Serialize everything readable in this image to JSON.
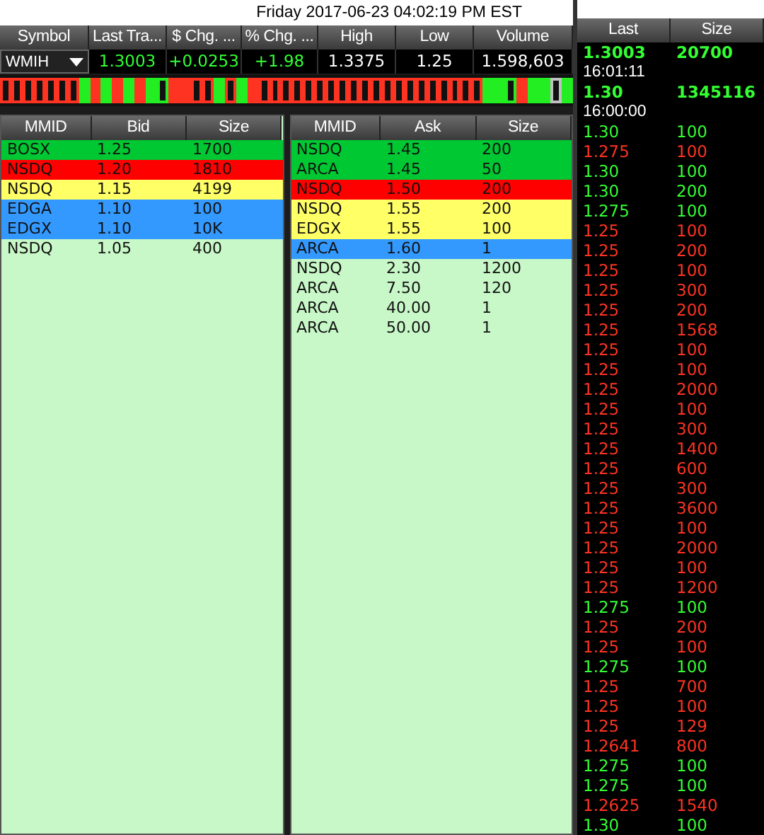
{
  "title": "Friday 2017-06-23 04:02:19 PM EST",
  "quote": {
    "columns": [
      "Symbol",
      "Last Tra...",
      "$ Chg. ...",
      "% Chg. ...",
      "High",
      "Low",
      "Volume"
    ],
    "symbol": "WMIH",
    "values": [
      {
        "text": "1.3003",
        "color": "#33ff33"
      },
      {
        "text": "+0.0253",
        "color": "#33ff33"
      },
      {
        "text": "+1.98",
        "color": "#33ff33"
      },
      {
        "text": "1.3375",
        "color": "#ffffff"
      },
      {
        "text": "1.25",
        "color": "#ffffff"
      },
      {
        "text": "1.598,603",
        "color": "#ffffff"
      }
    ]
  },
  "ticks": [
    {
      "color": "#ff3322",
      "filled": false
    },
    {
      "color": "#ff3322",
      "filled": false
    },
    {
      "color": "#ff3322",
      "filled": false
    },
    {
      "color": "#ff3322",
      "filled": false
    },
    {
      "color": "#ff3322",
      "filled": false
    },
    {
      "color": "#ff3322",
      "filled": false
    },
    {
      "color": "#ff3322",
      "filled": false
    },
    {
      "color": "#22ee22",
      "filled": true
    },
    {
      "color": "#ff3322",
      "filled": true
    },
    {
      "color": "#22ee22",
      "filled": true
    },
    {
      "color": "#ff3322",
      "filled": true
    },
    {
      "color": "#22ee22",
      "filled": true
    },
    {
      "color": "#ff3322",
      "filled": true
    },
    {
      "color": "#22ee22",
      "filled": true
    },
    {
      "color": "#22ee22",
      "filled": false
    },
    {
      "color": "#ff3322",
      "filled": true
    },
    {
      "color": "#ff3322",
      "filled": true
    },
    {
      "color": "#ff3322",
      "filled": false
    },
    {
      "color": "#ff3322",
      "filled": false
    },
    {
      "color": "#22ee22",
      "filled": true
    },
    {
      "color": "#ff3322",
      "filled": false
    },
    {
      "color": "#22ee22",
      "filled": true
    },
    {
      "color": "#ff3322",
      "filled": true
    },
    {
      "color": "#ff3322",
      "filled": false
    },
    {
      "color": "#ff3322",
      "filled": false
    },
    {
      "color": "#ff3322",
      "filled": false
    },
    {
      "color": "#ff3322",
      "filled": false
    },
    {
      "color": "#ff3322",
      "filled": false
    },
    {
      "color": "#ff3322",
      "filled": false
    },
    {
      "color": "#ff3322",
      "filled": false
    },
    {
      "color": "#ff3322",
      "filled": false
    },
    {
      "color": "#ff3322",
      "filled": false
    },
    {
      "color": "#ff3322",
      "filled": false
    },
    {
      "color": "#ff3322",
      "filled": false
    },
    {
      "color": "#ff3322",
      "filled": false
    },
    {
      "color": "#ff3322",
      "filled": false
    },
    {
      "color": "#ff3322",
      "filled": false
    },
    {
      "color": "#ff3322",
      "filled": false
    },
    {
      "color": "#ff3322",
      "filled": false
    },
    {
      "color": "#ff3322",
      "filled": false
    },
    {
      "color": "#ff3322",
      "filled": false
    },
    {
      "color": "#ff3322",
      "filled": false
    },
    {
      "color": "#ff3322",
      "filled": false
    },
    {
      "color": "#22ee22",
      "filled": true
    },
    {
      "color": "#22ee22",
      "filled": true
    },
    {
      "color": "#22ee22",
      "filled": false
    },
    {
      "color": "#ff3322",
      "filled": true
    },
    {
      "color": "#22ee22",
      "filled": true
    },
    {
      "color": "#22ee22",
      "filled": true
    },
    {
      "color": "#c0c0c0",
      "filled": false
    },
    {
      "color": "#22ee22",
      "filled": true
    }
  ],
  "bid": {
    "columns": [
      "MMID",
      "Bid",
      "Size"
    ],
    "rows": [
      {
        "cells": [
          "BOSX",
          "1.25",
          "1700"
        ],
        "color": "#00c832"
      },
      {
        "cells": [
          "NSDQ",
          "1.20",
          "1810"
        ],
        "color": "#ff0000"
      },
      {
        "cells": [
          "NSDQ",
          "1.15",
          "4199"
        ],
        "color": "#ffff66"
      },
      {
        "cells": [
          "EDGA",
          "1.10",
          "100"
        ],
        "color": "#3399ff"
      },
      {
        "cells": [
          "EDGX",
          "1.10",
          "10K"
        ],
        "color": "#3399ff"
      },
      {
        "cells": [
          "NSDQ",
          "1.05",
          "400"
        ],
        "color": "#c8f8c8"
      }
    ]
  },
  "ask": {
    "columns": [
      "MMID",
      "Ask",
      "Size"
    ],
    "rows": [
      {
        "cells": [
          "NSDQ",
          "1.45",
          "200"
        ],
        "color": "#00c832"
      },
      {
        "cells": [
          "ARCA",
          "1.45",
          "50"
        ],
        "color": "#00c832"
      },
      {
        "cells": [
          "NSDQ",
          "1.50",
          "200"
        ],
        "color": "#ff0000"
      },
      {
        "cells": [
          "NSDQ",
          "1.55",
          "200"
        ],
        "color": "#ffff66"
      },
      {
        "cells": [
          "EDGX",
          "1.55",
          "100"
        ],
        "color": "#ffff66"
      },
      {
        "cells": [
          "ARCA",
          "1.60",
          "1"
        ],
        "color": "#3399ff"
      },
      {
        "cells": [
          "NSDQ",
          "2.30",
          "1200"
        ],
        "color": "#c8f8c8"
      },
      {
        "cells": [
          "ARCA",
          "7.50",
          "120"
        ],
        "color": "#c8f8c8"
      },
      {
        "cells": [
          "ARCA",
          "40.00",
          "1"
        ],
        "color": "#c8f8c8"
      },
      {
        "cells": [
          "ARCA",
          "50.00",
          "1"
        ],
        "color": "#c8f8c8"
      }
    ]
  },
  "time_sales": {
    "columns": [
      "Last",
      "Size"
    ],
    "rows": [
      {
        "kind": "summary",
        "last": "1.3003",
        "size": "20700",
        "color": "#33ff33"
      },
      {
        "kind": "time",
        "last": "16:01:11"
      },
      {
        "kind": "summary",
        "last": "1.30",
        "size": "1345116",
        "color": "#33ff33"
      },
      {
        "kind": "time",
        "last": "16:00:00"
      },
      {
        "kind": "trade",
        "last": "1.30",
        "size": "100",
        "color": "#33ff33"
      },
      {
        "kind": "trade",
        "last": "1.275",
        "size": "100",
        "color": "#ff3322"
      },
      {
        "kind": "trade",
        "last": "1.30",
        "size": "100",
        "color": "#33ff33"
      },
      {
        "kind": "trade",
        "last": "1.30",
        "size": "200",
        "color": "#33ff33"
      },
      {
        "kind": "trade",
        "last": "1.275",
        "size": "100",
        "color": "#33ff33"
      },
      {
        "kind": "trade",
        "last": "1.25",
        "size": "100",
        "color": "#ff3322"
      },
      {
        "kind": "trade",
        "last": "1.25",
        "size": "200",
        "color": "#ff3322"
      },
      {
        "kind": "trade",
        "last": "1.25",
        "size": "100",
        "color": "#ff3322"
      },
      {
        "kind": "trade",
        "last": "1.25",
        "size": "300",
        "color": "#ff3322"
      },
      {
        "kind": "trade",
        "last": "1.25",
        "size": "200",
        "color": "#ff3322"
      },
      {
        "kind": "trade",
        "last": "1.25",
        "size": "1568",
        "color": "#ff3322"
      },
      {
        "kind": "trade",
        "last": "1.25",
        "size": "100",
        "color": "#ff3322"
      },
      {
        "kind": "trade",
        "last": "1.25",
        "size": "100",
        "color": "#ff3322"
      },
      {
        "kind": "trade",
        "last": "1.25",
        "size": "2000",
        "color": "#ff3322"
      },
      {
        "kind": "trade",
        "last": "1.25",
        "size": "100",
        "color": "#ff3322"
      },
      {
        "kind": "trade",
        "last": "1.25",
        "size": "300",
        "color": "#ff3322"
      },
      {
        "kind": "trade",
        "last": "1.25",
        "size": "1400",
        "color": "#ff3322"
      },
      {
        "kind": "trade",
        "last": "1.25",
        "size": "600",
        "color": "#ff3322"
      },
      {
        "kind": "trade",
        "last": "1.25",
        "size": "300",
        "color": "#ff3322"
      },
      {
        "kind": "trade",
        "last": "1.25",
        "size": "3600",
        "color": "#ff3322"
      },
      {
        "kind": "trade",
        "last": "1.25",
        "size": "100",
        "color": "#ff3322"
      },
      {
        "kind": "trade",
        "last": "1.25",
        "size": "2000",
        "color": "#ff3322"
      },
      {
        "kind": "trade",
        "last": "1.25",
        "size": "100",
        "color": "#ff3322"
      },
      {
        "kind": "trade",
        "last": "1.25",
        "size": "1200",
        "color": "#ff3322"
      },
      {
        "kind": "trade",
        "last": "1.275",
        "size": "100",
        "color": "#33ff33"
      },
      {
        "kind": "trade",
        "last": "1.25",
        "size": "200",
        "color": "#ff3322"
      },
      {
        "kind": "trade",
        "last": "1.25",
        "size": "100",
        "color": "#ff3322"
      },
      {
        "kind": "trade",
        "last": "1.275",
        "size": "100",
        "color": "#33ff33"
      },
      {
        "kind": "trade",
        "last": "1.25",
        "size": "700",
        "color": "#ff3322"
      },
      {
        "kind": "trade",
        "last": "1.25",
        "size": "100",
        "color": "#ff3322"
      },
      {
        "kind": "trade",
        "last": "1.25",
        "size": "129",
        "color": "#ff3322"
      },
      {
        "kind": "trade",
        "last": "1.2641",
        "size": "800",
        "color": "#ff3322"
      },
      {
        "kind": "trade",
        "last": "1.275",
        "size": "100",
        "color": "#33ff33"
      },
      {
        "kind": "trade",
        "last": "1.275",
        "size": "100",
        "color": "#33ff33"
      },
      {
        "kind": "trade",
        "last": "1.2625",
        "size": "1540",
        "color": "#ff3322"
      },
      {
        "kind": "trade",
        "last": "1.30",
        "size": "100",
        "color": "#33ff33"
      }
    ]
  }
}
